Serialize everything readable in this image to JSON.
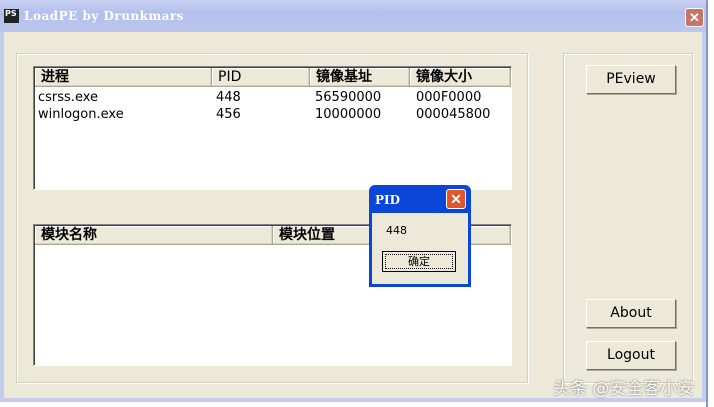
{
  "window": {
    "title": "LoadPE by Drunkmars",
    "icon_text": "PS"
  },
  "process_list": {
    "headers": [
      "进程",
      "PID",
      "镜像基址",
      "镜像大小"
    ],
    "rows": [
      [
        "csrss.exe",
        "448",
        "56590000",
        "000F0000"
      ],
      [
        "winlogon.exe",
        "456",
        "10000000",
        "000045800"
      ]
    ]
  },
  "module_list": {
    "headers": [
      "模块名称",
      "模块位置"
    ]
  },
  "buttons": {
    "peview": "PEview",
    "about": "About",
    "logout": "Logout"
  },
  "dialog": {
    "title": "PID",
    "message": "448",
    "ok": "确定"
  },
  "watermark": "头条 @安全客小安",
  "colors": {
    "dialog_title": "#0a46d8",
    "face": "#ece9d8"
  }
}
